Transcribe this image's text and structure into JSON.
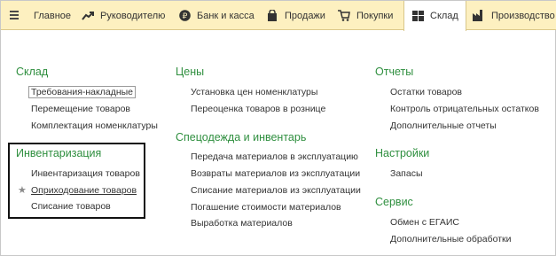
{
  "topbar": {
    "tabs": [
      {
        "label": "Главное",
        "icon": "house-icon"
      },
      {
        "label": "Руководителю",
        "icon": "trend-icon"
      },
      {
        "label": "Банк и касса",
        "icon": "ruble-icon"
      },
      {
        "label": "Продажи",
        "icon": "bag-icon"
      },
      {
        "label": "Покупки",
        "icon": "cart-icon"
      },
      {
        "label": "Склад",
        "icon": "grid-icon",
        "active": true
      },
      {
        "label": "Производство",
        "icon": "factory-icon"
      }
    ]
  },
  "sections": {
    "sklad": {
      "title": "Склад",
      "items": [
        "Требования-накладные",
        "Перемещение товаров",
        "Комплектация номенклатуры"
      ]
    },
    "inventory": {
      "title": "Инвентаризация",
      "items": [
        "Инвентаризация товаров",
        "Оприходование товаров",
        "Списание товаров"
      ]
    },
    "prices": {
      "title": "Цены",
      "items": [
        "Установка цен номенклатуры",
        "Переоценка товаров в рознице"
      ]
    },
    "specodezhda": {
      "title": "Спецодежда и инвентарь",
      "items": [
        "Передача материалов в эксплуатацию",
        "Возвраты материалов из эксплуатации",
        "Списание материалов из эксплуатации",
        "Погашение стоимости материалов",
        "Выработка материалов"
      ]
    },
    "reports": {
      "title": "Отчеты",
      "items": [
        "Остатки товаров",
        "Контроль отрицательных остатков",
        "Дополнительные отчеты"
      ]
    },
    "settings": {
      "title": "Настройки",
      "items": [
        "Запасы"
      ]
    },
    "service": {
      "title": "Сервис",
      "items": [
        "Обмен с ЕГАИС",
        "Дополнительные обработки"
      ]
    }
  },
  "colors": {
    "topbar_bg": "#fdf0c0",
    "group_title": "#2f8f3f",
    "link_text": "#333333",
    "highlight_border": "#111111"
  }
}
